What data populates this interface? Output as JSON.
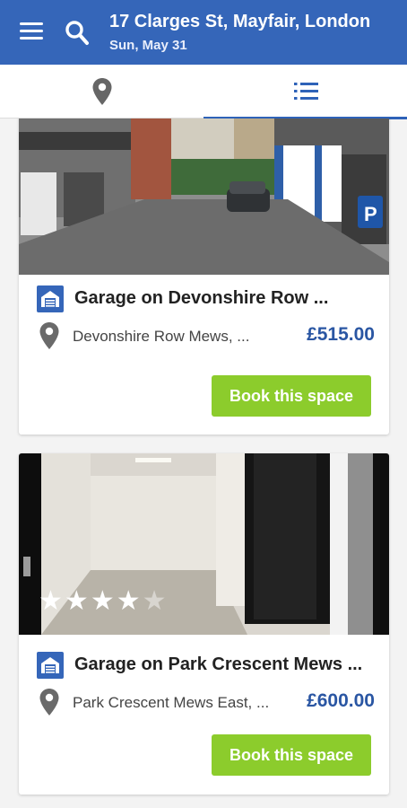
{
  "header": {
    "title": "17 Clarges St, Mayfair, London",
    "date": "Sun, May 31",
    "background": "#3566b9"
  },
  "tabs": [
    {
      "name": "map",
      "icon": "map-pin-icon",
      "active": false
    },
    {
      "name": "list",
      "icon": "list-icon",
      "active": true
    }
  ],
  "listings": [
    {
      "name": "Garage on Devonshire Row ...",
      "address": "Devonshire Row Mews, ...",
      "price": "£515.00",
      "button": "Book this space",
      "rating": null
    },
    {
      "name": "Garage on Park Crescent Mews ...",
      "address": "Park Crescent Mews East, ...",
      "price": "£600.00",
      "button": "Book this space",
      "rating": 4,
      "rating_max": 5
    }
  ],
  "colors": {
    "accent": "#3566b9",
    "price": "#2a56a3",
    "book_button": "#8ccc2c"
  }
}
